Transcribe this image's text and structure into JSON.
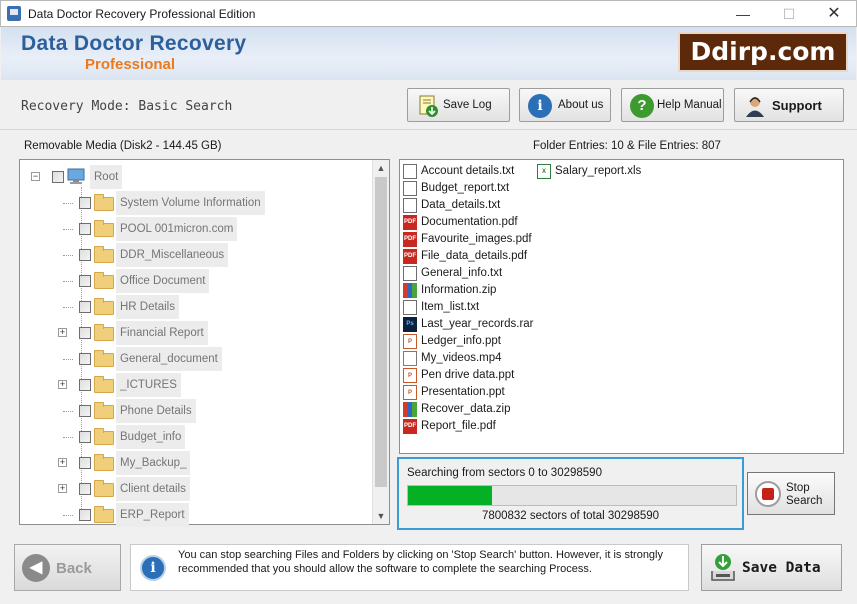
{
  "window": {
    "title": "Data Doctor Recovery Professional Edition",
    "minimize": "—",
    "maximize": "☐",
    "close": "✕"
  },
  "banner": {
    "brand": "Data Doctor Recovery",
    "edition": "Professional",
    "logo": "Ddirp.com"
  },
  "toolbar": {
    "mode": "Recovery Mode: Basic Search",
    "save_log": "Save Log",
    "about_us": "About us",
    "help_manual": "Help Manual",
    "support": "Support"
  },
  "media_info": "Removable Media (Disk2 - 144.45 GB)",
  "entries_info": "Folder Entries: 10 & File Entries: 807",
  "tree": {
    "root": "Root",
    "folders": [
      {
        "name": "System Volume Information",
        "expandable": false
      },
      {
        "name": "POOL 001micron.com",
        "expandable": false
      },
      {
        "name": "DDR_Miscellaneous",
        "expandable": false
      },
      {
        "name": "Office Document",
        "expandable": false
      },
      {
        "name": "HR Details",
        "expandable": false
      },
      {
        "name": "Financial Report",
        "expandable": true
      },
      {
        "name": "General_document",
        "expandable": false
      },
      {
        "name": "_ICTURES",
        "expandable": true
      },
      {
        "name": "Phone Details",
        "expandable": false
      },
      {
        "name": "Budget_info",
        "expandable": false
      },
      {
        "name": "My_Backup_",
        "expandable": true
      },
      {
        "name": "Client details",
        "expandable": true
      },
      {
        "name": "ERP_Report",
        "expandable": false
      }
    ]
  },
  "files": [
    {
      "name": "Account details.txt",
      "type": "txt"
    },
    {
      "name": "Budget_report.txt",
      "type": "txt"
    },
    {
      "name": "Data_details.txt",
      "type": "txt"
    },
    {
      "name": "Documentation.pdf",
      "type": "pdf"
    },
    {
      "name": "Favourite_images.pdf",
      "type": "pdf"
    },
    {
      "name": "File_data_details.pdf",
      "type": "pdf"
    },
    {
      "name": "General_info.txt",
      "type": "txt"
    },
    {
      "name": "Information.zip",
      "type": "zip"
    },
    {
      "name": "Item_list.txt",
      "type": "txt"
    },
    {
      "name": "Last_year_records.rar",
      "type": "ps"
    },
    {
      "name": "Ledger_info.ppt",
      "type": "ppt"
    },
    {
      "name": "My_videos.mp4",
      "type": "mp4"
    },
    {
      "name": "Pen drive data.ppt",
      "type": "ppt"
    },
    {
      "name": "Presentation.ppt",
      "type": "ppt"
    },
    {
      "name": "Recover_data.zip",
      "type": "zip"
    },
    {
      "name": "Report_file.pdf",
      "type": "pdf"
    },
    {
      "name": "Salary_report.xls",
      "type": "xls"
    }
  ],
  "progress": {
    "range_text": "Searching from sectors   0 to 30298590",
    "count_text": "7800832  sectors  of  total 30298590",
    "fraction": 0.2575
  },
  "stop_button": "Stop Search",
  "bottom": {
    "back": "Back",
    "hint": "You can stop searching Files and Folders by clicking on 'Stop Search' button. However, it is strongly recommended that you should allow the software to complete the searching Process.",
    "save_data": "Save Data"
  }
}
